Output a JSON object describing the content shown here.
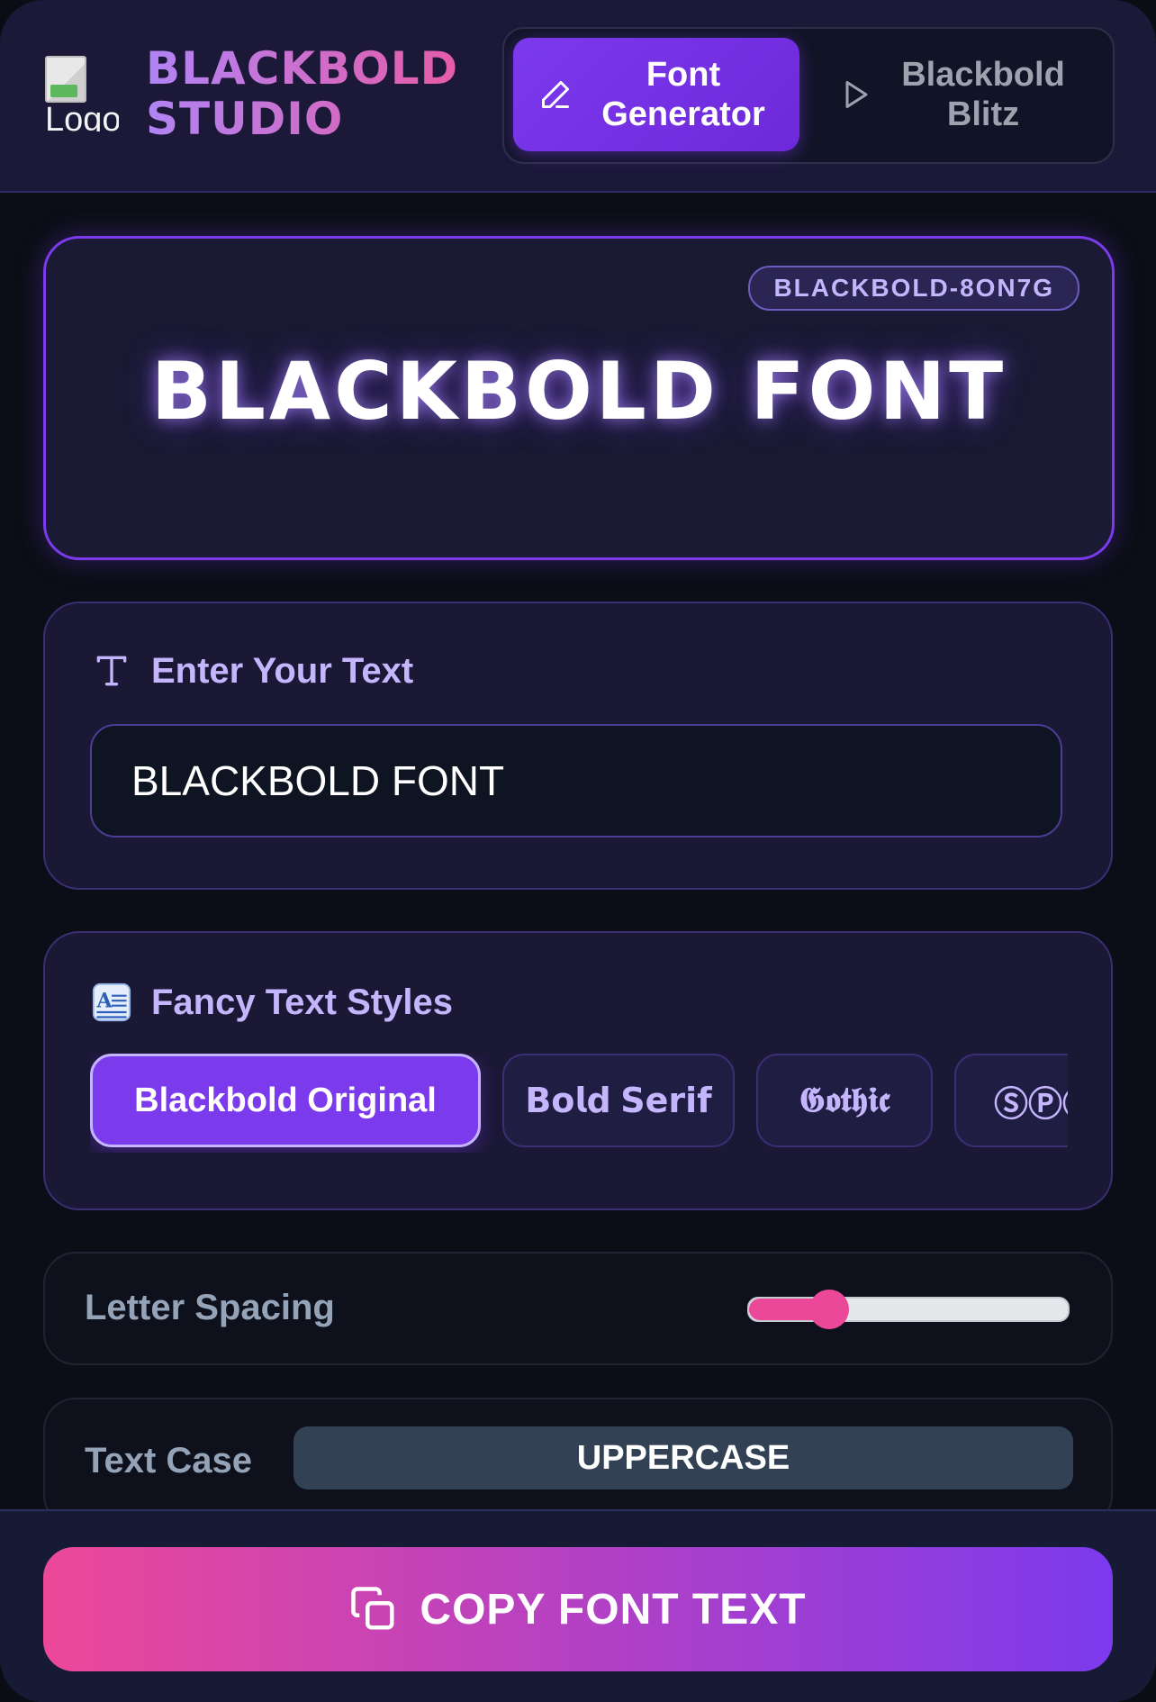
{
  "header": {
    "logo_alt": "Logo",
    "brand_line1": "BLACKBOLD",
    "brand_line2": "STUDIO",
    "tabs": [
      {
        "label": "Font Generator",
        "icon": "pencil-icon",
        "active": true
      },
      {
        "label": "Blackbold Blitz",
        "icon": "play-icon",
        "active": false
      }
    ]
  },
  "preview": {
    "badge": "BLACKBOLD-8ON7G",
    "text": "BLACKBOLD FONT"
  },
  "input_card": {
    "title": "Enter Your Text",
    "icon": "text-type-icon",
    "value": "BLACKBOLD FONT"
  },
  "styles_card": {
    "title": "Fancy Text Styles",
    "icon": "styles-icon",
    "styles": [
      {
        "label": "Blackbold Original",
        "active": true
      },
      {
        "label": "𝗕𝗼𝗹𝗱 𝗦𝗲𝗿𝗶𝗳",
        "active": false
      },
      {
        "label": "𝕲𝖔𝖙𝖍𝖎𝖈",
        "active": false
      },
      {
        "label": "ⓈⓅⓄ",
        "active": false
      }
    ]
  },
  "letter_spacing": {
    "label": "Letter Spacing",
    "value_fraction": 0.25
  },
  "text_case": {
    "label": "Text Case",
    "value": "UPPERCASE"
  },
  "footer": {
    "copy_label": "COPY FONT TEXT",
    "icon": "copy-icon"
  },
  "colors": {
    "accent": "#7c3aed",
    "pink": "#ec4899",
    "lavender": "#c4b5fd"
  }
}
